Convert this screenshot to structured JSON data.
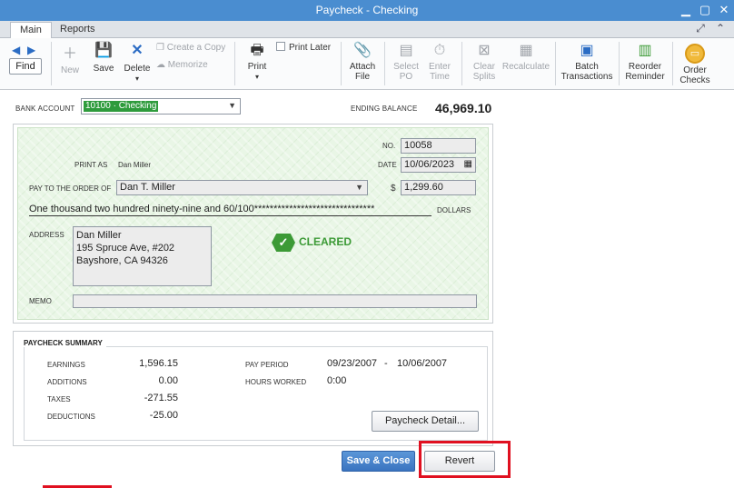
{
  "window": {
    "title": "Paycheck - Checking"
  },
  "tabs": [
    {
      "label": "Main"
    },
    {
      "label": "Reports"
    }
  ],
  "toolbar": {
    "find": "Find",
    "new": "New",
    "save": "Save",
    "delete": "Delete",
    "create_copy": "Create a Copy",
    "memorize": "Memorize",
    "print": "Print",
    "print_later": "Print Later",
    "attach_file_1": "Attach",
    "attach_file_2": "File",
    "select_po_1": "Select",
    "select_po_2": "PO",
    "enter_time_1": "Enter",
    "enter_time_2": "Time",
    "clear_splits_1": "Clear",
    "clear_splits_2": "Splits",
    "recalculate": "Recalculate",
    "batch_1": "Batch",
    "batch_2": "Transactions",
    "reorder_1": "Reorder",
    "reorder_2": "Reminder",
    "order_checks_1": "Order",
    "order_checks_2": "Checks"
  },
  "bank": {
    "label": "BANK ACCOUNT",
    "account": "10100 · Checking",
    "ending_balance_label": "ENDING BALANCE",
    "ending_balance": "46,969.10"
  },
  "check": {
    "no_label": "NO.",
    "no": "10058",
    "date_label": "DATE",
    "date": "10/06/2023",
    "print_as_label": "PRINT AS",
    "print_as": "Dan Miller",
    "pay_to_label": "PAY TO THE ORDER OF",
    "payee": "Dan T. Miller",
    "dollar_sign": "$",
    "amount": "1,299.60",
    "amount_words": "One thousand two hundred ninety-nine and 60/100*******************************",
    "dollars_label": "DOLLARS",
    "address_label": "ADDRESS",
    "address_line1": "Dan Miller",
    "address_line2": "195 Spruce Ave, #202",
    "address_line3": "Bayshore, CA 94326",
    "status": "CLEARED",
    "memo_label": "MEMO",
    "memo": ""
  },
  "summary": {
    "title": "PAYCHECK SUMMARY",
    "earnings_label": "EARNINGS",
    "earnings": "1,596.15",
    "additions_label": "ADDITIONS",
    "additions": "0.00",
    "taxes_label": "TAXES",
    "taxes": "-271.55",
    "deductions_label": "DEDUCTIONS",
    "deductions": "-25.00",
    "pay_period_label": "PAY PERIOD",
    "pay_period_start": "09/23/2007",
    "pay_period_sep": "-",
    "pay_period_end": "10/06/2007",
    "hours_worked_label": "HOURS WORKED",
    "hours_worked": "0:00",
    "detail_button": "Paycheck Detail..."
  },
  "footer": {
    "save_close": "Save & Close",
    "revert": "Revert"
  },
  "colors": {
    "titlebar": "#4a8dd0",
    "cleared": "#3c9a36",
    "highlight": "#e01020"
  }
}
